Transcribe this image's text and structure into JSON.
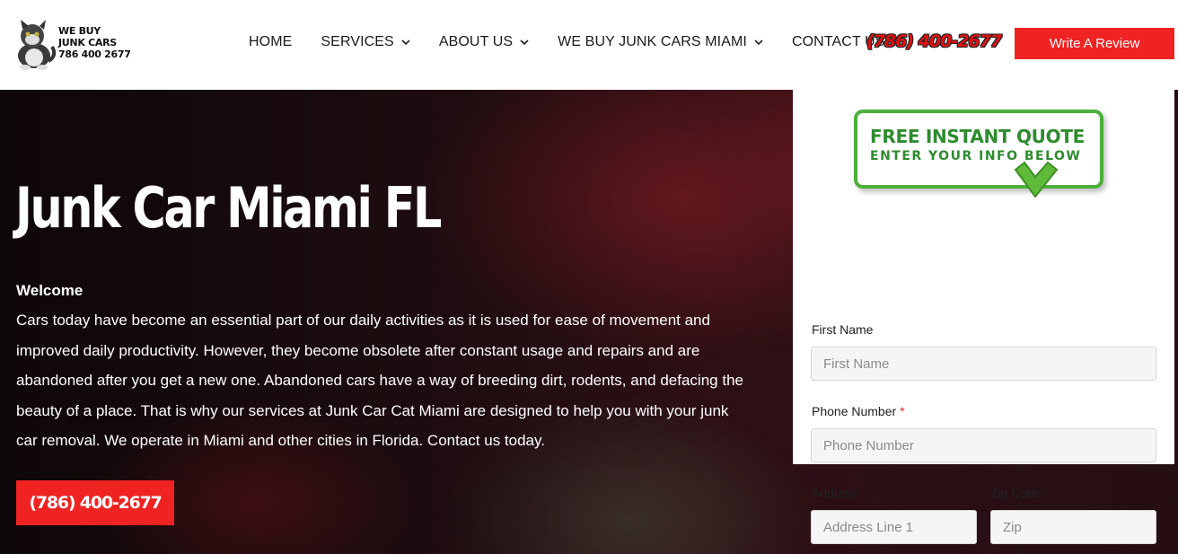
{
  "brand": {
    "logo_line1": "WE BUY",
    "logo_line2": "JUNK CARS",
    "logo_line3": "786 400 2677",
    "logo_icon": "cat-mascot-icon"
  },
  "nav": {
    "items": [
      {
        "label": "HOME",
        "has_dropdown": false
      },
      {
        "label": "SERVICES",
        "has_dropdown": true
      },
      {
        "label": "ABOUT US",
        "has_dropdown": true
      },
      {
        "label": "WE BUY JUNK CARS MIAMI",
        "has_dropdown": true
      },
      {
        "label": "CONTACT US",
        "has_dropdown": false
      }
    ],
    "phone": "(786) 400-2677",
    "review_button": "Write A Review"
  },
  "hero": {
    "title": "Junk Car Miami FL",
    "welcome": "Welcome",
    "body": "Cars today have become an essential part of our daily activities as it is used for ease of movement and improved daily productivity. However, they become obsolete after constant usage and repairs and are abandoned after you get a new one. Abandoned cars have a way of breeding dirt, rodents, and defacing the beauty of a place. That is why our services at Junk Car Cat Miami are designed to help you with your junk car removal. We operate in Miami and other cities in Florida. Contact us today.",
    "phone_button": "(786) 400-2677"
  },
  "quote_form": {
    "badge_line1": "FREE INSTANT QUOTE",
    "badge_line2": "ENTER YOUR INFO BELOW",
    "first_name": {
      "label": "First Name",
      "placeholder": "First Name",
      "value": ""
    },
    "phone": {
      "label": "Phone Number",
      "required_mark": "*",
      "placeholder": "Phone Number",
      "value": ""
    },
    "address": {
      "label": "Address",
      "placeholder": "Address Line 1",
      "value": ""
    },
    "zip": {
      "label": "Zip Code",
      "placeholder": "Zip",
      "value": ""
    }
  },
  "colors": {
    "accent_red": "#f02323",
    "badge_green": "#4caf3b",
    "nav_text": "#1a1a1a"
  }
}
